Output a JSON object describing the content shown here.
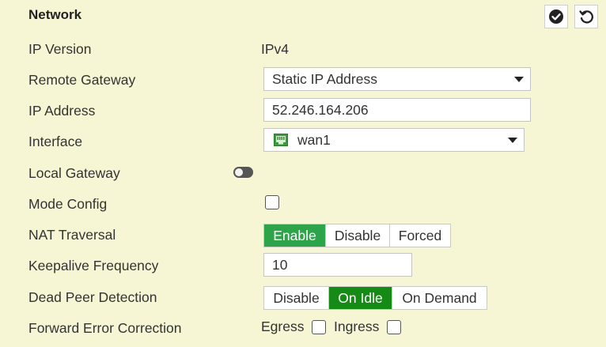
{
  "section": {
    "title": "Network"
  },
  "header_buttons": {
    "apply_icon": "check-circle-icon",
    "reset_icon": "undo-icon"
  },
  "rows": {
    "ip_version": {
      "label": "IP Version",
      "value": "IPv4"
    },
    "remote_gateway": {
      "label": "Remote Gateway",
      "value": "Static IP Address"
    },
    "ip_address": {
      "label": "IP Address",
      "value": "52.246.164.206"
    },
    "interface": {
      "label": "Interface",
      "value": "wan1",
      "icon": "network-port-icon"
    },
    "local_gateway": {
      "label": "Local Gateway",
      "enabled": false
    },
    "mode_config": {
      "label": "Mode Config",
      "checked": false
    },
    "nat_traversal": {
      "label": "NAT Traversal",
      "options": [
        "Enable",
        "Disable",
        "Forced"
      ],
      "selected": "Enable"
    },
    "keepalive_frequency": {
      "label": "Keepalive Frequency",
      "value": "10"
    },
    "dead_peer_detection": {
      "label": "Dead Peer Detection",
      "options": [
        "Disable",
        "On Idle",
        "On Demand"
      ],
      "selected": "On Idle"
    },
    "forward_error_correction": {
      "label": "Forward Error Correction",
      "egress_label": "Egress",
      "egress_checked": false,
      "ingress_label": "Ingress",
      "ingress_checked": false
    }
  },
  "colors": {
    "background": "#f6f6d4",
    "nat_enable_active": "#2ea44a",
    "dpd_on_idle_active": "#158a15",
    "port_icon_green": "#3b9b3b"
  }
}
